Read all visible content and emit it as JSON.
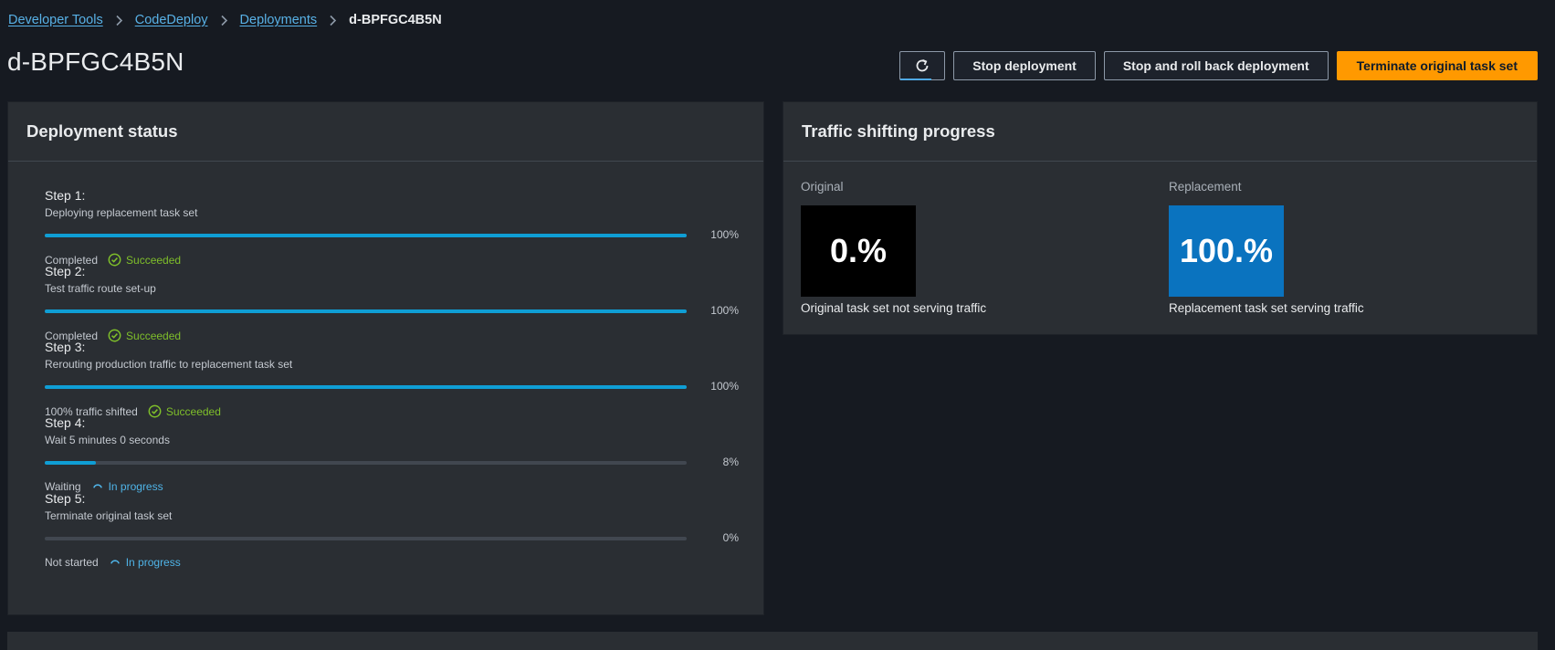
{
  "breadcrumb": {
    "items": [
      "Developer Tools",
      "CodeDeploy",
      "Deployments"
    ],
    "current": "d-BPFGC4B5N"
  },
  "page": {
    "title": "d-BPFGC4B5N"
  },
  "actions": {
    "refresh_icon": "refresh-icon",
    "stop": "Stop deployment",
    "stop_rollback": "Stop and roll back deployment",
    "terminate": "Terminate original task set"
  },
  "status_panel": {
    "title": "Deployment status",
    "steps": [
      {
        "title": "Step 1:",
        "desc": "Deploying replacement task set",
        "progress": 100,
        "pct": "100%",
        "state": "Completed",
        "status": "Succeeded",
        "status_type": "success"
      },
      {
        "title": "Step 2:",
        "desc": "Test traffic route set-up",
        "progress": 100,
        "pct": "100%",
        "state": "Completed",
        "status": "Succeeded",
        "status_type": "success"
      },
      {
        "title": "Step 3:",
        "desc": "Rerouting production traffic to replacement task set",
        "progress": 100,
        "pct": "100%",
        "state": "100% traffic shifted",
        "status": "Succeeded",
        "status_type": "success"
      },
      {
        "title": "Step 4:",
        "desc": "Wait 5 minutes 0 seconds",
        "progress": 8,
        "pct": "8%",
        "state": "Waiting",
        "status": "In progress",
        "status_type": "in-progress"
      },
      {
        "title": "Step 5:",
        "desc": "Terminate original task set",
        "progress": 0,
        "pct": "0%",
        "state": "Not started",
        "status": "In progress",
        "status_type": "in-progress"
      }
    ]
  },
  "traffic_panel": {
    "title": "Traffic shifting progress",
    "original": {
      "label": "Original",
      "value": "0.%",
      "caption": "Original task set not serving traffic"
    },
    "replacement": {
      "label": "Replacement",
      "value": "100.%",
      "caption": "Replacement task set serving traffic"
    }
  },
  "colors": {
    "accent_link": "#58b1e6",
    "primary_button": "#ff9900",
    "progress_fill": "#0f9ed5",
    "success": "#7fbf2a",
    "in_progress": "#4fb4e8",
    "replacement_box": "#0a73bf"
  }
}
